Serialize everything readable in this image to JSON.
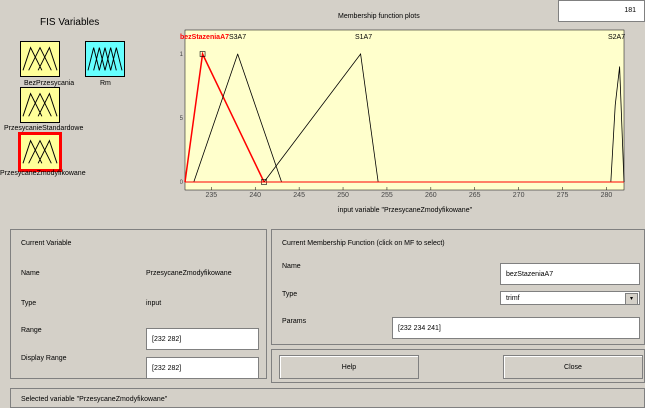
{
  "fis": {
    "title": "FIS Variables",
    "variables": [
      {
        "label": "BezPrzesycania",
        "selected": false,
        "kind": "input"
      },
      {
        "label": "Rm",
        "selected": false,
        "kind": "output"
      },
      {
        "label": "PrzesycanieStandardowe",
        "selected": false,
        "kind": "input"
      },
      {
        "label": "PrzesycaneZmodyfikowane",
        "selected": true,
        "kind": "input"
      }
    ]
  },
  "plot": {
    "title": "Membership function plots",
    "points_value": "181",
    "xlabel": "input variable \"PrzesycaneZmodyfikowane\"",
    "mf_labels": [
      {
        "text": "bezStazeniaA7",
        "selected": true
      },
      {
        "text": "S3A7",
        "selected": false
      },
      {
        "text": "S1A7",
        "selected": false
      },
      {
        "text": "S2A7",
        "selected": false
      }
    ],
    "y_ticks": [
      "0",
      "0.5",
      "1"
    ],
    "x_ticks": [
      "235",
      "240",
      "245",
      "250",
      "255",
      "260",
      "265",
      "270",
      "275",
      "280"
    ]
  },
  "chart_data": {
    "type": "line",
    "xlabel": "input variable \"PrzesycaneZmodyfikowane\"",
    "xlim": [
      232,
      282
    ],
    "ylim": [
      0,
      1
    ],
    "x_ticks": [
      235,
      240,
      245,
      250,
      255,
      260,
      265,
      270,
      275,
      280
    ],
    "y_ticks": [
      0,
      0.5,
      1
    ],
    "series": [
      {
        "name": "bezStazeniaA7",
        "shape": "trimf",
        "x": [
          232,
          234,
          241
        ],
        "y": [
          0,
          1,
          0
        ],
        "color": "#ff0000"
      },
      {
        "name": "S3A7",
        "shape": "bell",
        "x": [
          233,
          236,
          238,
          240,
          243
        ],
        "y": [
          0,
          0.6,
          1,
          0.6,
          0
        ],
        "color": "#000000"
      },
      {
        "name": "S1A7",
        "shape": "trimf",
        "x": [
          241,
          252,
          254
        ],
        "y": [
          0,
          1,
          0
        ],
        "color": "#000000"
      },
      {
        "name": "S2A7",
        "shape": "bell",
        "x": [
          280.5,
          281,
          281.5,
          282
        ],
        "y": [
          0,
          0.6,
          0.9,
          0
        ],
        "color": "#000000"
      }
    ]
  },
  "current_variable": {
    "header": "Current Variable",
    "name_label": "Name",
    "name_value": "PrzesycaneZmodyfikowane",
    "type_label": "Type",
    "type_value": "input",
    "range_label": "Range",
    "range_value": "[232 282]",
    "display_range_label": "Display Range",
    "display_range_value": "[232 282]"
  },
  "current_mf": {
    "header": "Current Membership Function (click on MF to select)",
    "name_label": "Name",
    "name_value": "bezStazeniaA7",
    "type_label": "Type",
    "type_value": "trimf",
    "params_label": "Params",
    "params_value": "[232 234 241]"
  },
  "buttons": {
    "help": "Help",
    "close": "Close"
  },
  "status": "Selected variable \"PrzesycaneZmodyfikowane\"",
  "colors": {
    "plot_bg": "#ffffcc",
    "tile_yellow": "#ffff99",
    "tile_cyan": "#66ffff",
    "selected": "#ff0000"
  }
}
